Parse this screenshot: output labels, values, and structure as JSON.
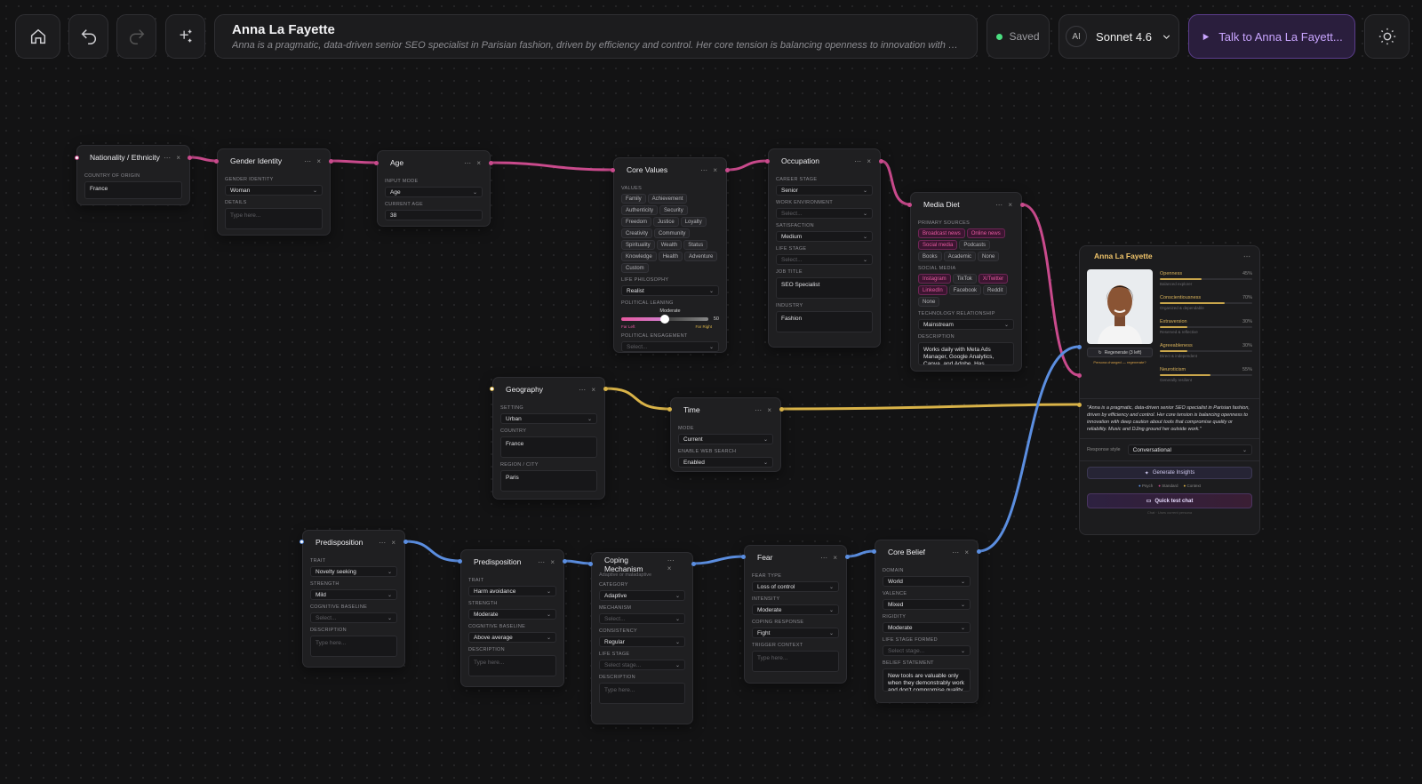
{
  "header": {
    "title": "Anna La Fayette",
    "subtitle": "Anna is a pragmatic, data-driven senior SEO specialist in Parisian fashion, driven by efficiency and control. Her core tension is balancing openness to innovation with deep cauti...",
    "saved_label": "Saved",
    "model_label": "Sonnet 4.6",
    "model_icon": "AI",
    "talk_label": "Talk to Anna La Fayett..."
  },
  "nodes": {
    "nationality": {
      "title": "Nationality / Ethnicity",
      "country_label": "COUNTRY OF ORIGIN",
      "country": "France"
    },
    "gender": {
      "title": "Gender Identity",
      "identity_label": "GENDER IDENTITY",
      "identity": "Woman",
      "details_label": "DETAILS",
      "details_placeholder": "Type here..."
    },
    "age": {
      "title": "Age",
      "mode_label": "INPUT MODE",
      "mode": "Age",
      "current_label": "CURRENT AGE",
      "current": "38"
    },
    "values": {
      "title": "Core Values",
      "values_label": "VALUES",
      "chips": [
        "Family",
        "Achievement",
        "Authenticity",
        "Security",
        "Freedom",
        "Justice",
        "Loyalty",
        "Creativity",
        "Community",
        "Spirituality",
        "Wealth",
        "Status",
        "Knowledge",
        "Health",
        "Adventure",
        "Custom"
      ],
      "philosophy_label": "LIFE PHILOSOPHY",
      "philosophy": "Realist",
      "political_label": "POLITICAL LEANING",
      "political_value_text": "Moderate",
      "political_number": "50",
      "political_fraction": 0.5,
      "far_left": "Far Left",
      "far_right": "Far Right",
      "engagement_label": "POLITICAL ENGAGEMENT",
      "engagement_placeholder": "Select..."
    },
    "occupation": {
      "title": "Occupation",
      "stage_label": "CAREER STAGE",
      "stage": "Senior",
      "work_label": "WORK ENVIRONMENT",
      "work_placeholder": "Select...",
      "satisfaction_label": "SATISFACTION",
      "satisfaction": "Medium",
      "life_label": "LIFE STAGE",
      "life_placeholder": "Select...",
      "job_label": "JOB TITLE",
      "job": "SEO Specialist",
      "industry_label": "INDUSTRY",
      "industry": "Fashion"
    },
    "media": {
      "title": "Media Diet",
      "sources_label": "PRIMARY SOURCES",
      "sources": [
        {
          "t": "Broadcast news",
          "on": true
        },
        {
          "t": "Online news",
          "on": true
        },
        {
          "t": "Social media",
          "on": true
        },
        {
          "t": "Podcasts",
          "on": false
        },
        {
          "t": "Books",
          "on": false
        },
        {
          "t": "Academic",
          "on": false
        },
        {
          "t": "None",
          "on": false
        }
      ],
      "social_label": "SOCIAL MEDIA",
      "social": [
        {
          "t": "Instagram",
          "on": true
        },
        {
          "t": "TikTok",
          "on": false
        },
        {
          "t": "X/Twitter",
          "on": true
        },
        {
          "t": "LinkedIn",
          "on": true
        },
        {
          "t": "Facebook",
          "on": false
        },
        {
          "t": "Reddit",
          "on": false
        },
        {
          "t": "None",
          "on": false
        }
      ],
      "tech_label": "TECHNOLOGY RELATIONSHIP",
      "tech": "Mainstream",
      "desc_label": "DESCRIPTION",
      "desc": "Works daily with Meta Ads Manager, Google Analytics, Canva, and Adobe. Has experimented with"
    },
    "geography": {
      "title": "Geography",
      "setting_label": "SETTING",
      "setting": "Urban",
      "country_label": "COUNTRY",
      "country": "France",
      "region_label": "REGION / CITY",
      "region": "Paris"
    },
    "time": {
      "title": "Time",
      "mode_label": "MODE",
      "mode": "Current",
      "web_label": "ENABLE WEB SEARCH",
      "web": "Enabled"
    },
    "pred1": {
      "title": "Predisposition",
      "trait_label": "TRAIT",
      "trait": "Novelty seeking",
      "strength_label": "STRENGTH",
      "strength": "Mild",
      "cog_label": "COGNITIVE BASELINE",
      "cog_placeholder": "Select...",
      "desc_label": "DESCRIPTION",
      "desc_placeholder": "Type here..."
    },
    "pred2": {
      "title": "Predisposition",
      "trait_label": "TRAIT",
      "trait": "Harm avoidance",
      "strength_label": "STRENGTH",
      "strength": "Moderate",
      "cog_label": "COGNITIVE BASELINE",
      "cog": "Above average",
      "desc_label": "DESCRIPTION",
      "desc_placeholder": "Type here..."
    },
    "coping": {
      "title": "Coping Mechanism",
      "subtitle": "Adaptive or maladaptive",
      "category_label": "CATEGORY",
      "category": "Adaptive",
      "mechanism_label": "MECHANISM",
      "mechanism_placeholder": "Select...",
      "consistency_label": "CONSISTENCY",
      "consistency": "Regular",
      "life_label": "LIFE STAGE",
      "life_placeholder": "Select stage...",
      "desc_label": "DESCRIPTION",
      "desc_placeholder": "Type here..."
    },
    "fear": {
      "title": "Fear",
      "type_label": "FEAR TYPE",
      "type": "Loss of control",
      "intensity_label": "INTENSITY",
      "intensity": "Moderate",
      "coping_label": "COPING RESPONSE",
      "coping": "Fight",
      "trigger_label": "TRIGGER CONTEXT",
      "trigger_placeholder": "Type here..."
    },
    "belief": {
      "title": "Core Belief",
      "domain_label": "DOMAIN",
      "domain": "World",
      "valence_label": "VALENCE",
      "valence": "Mixed",
      "rigidity_label": "RIGIDITY",
      "rigidity": "Moderate",
      "life_label": "LIFE STAGE FORMED",
      "life_placeholder": "Select stage...",
      "statement_label": "BELIEF STATEMENT",
      "statement": "New tools are valuable only when they demonstrably work and don't compromise quality or"
    }
  },
  "persona": {
    "name": "Anna La Fayette",
    "regen_label": "Regenerate (3 left)",
    "changed_note": "Persona changed — regenerate?",
    "traits": [
      {
        "name": "Openness",
        "pct": "45%",
        "value": 0.45,
        "note": "Balanced explorer"
      },
      {
        "name": "Conscientiousness",
        "pct": "70%",
        "value": 0.7,
        "note": "Organized & dependable"
      },
      {
        "name": "Extraversion",
        "pct": "30%",
        "value": 0.3,
        "note": "Reserved & reflective"
      },
      {
        "name": "Agreeableness",
        "pct": "30%",
        "value": 0.3,
        "note": "Direct & independent"
      },
      {
        "name": "Neuroticism",
        "pct": "55%",
        "value": 0.55,
        "note": "Generally resilient"
      }
    ],
    "quote": "\"Anna is a pragmatic, data-driven senior SEO specialist in Parisian fashion, driven by efficiency and control. Her core tension is balancing openness to innovation with deep caution about tools that compromise quality or reliability. Music and DJing ground her outside work.\"",
    "response_label": "Response style",
    "response": "Conversational",
    "insights_label": "Generate Insights",
    "legend": [
      "Psych",
      "Standard",
      "Context"
    ],
    "chat_label": "Quick test chat",
    "chat_note": "Chat · Uses current persona"
  },
  "colors": {
    "pink": "#c94a8c",
    "yellow": "#d9b348",
    "blue": "#5b8ee0"
  }
}
